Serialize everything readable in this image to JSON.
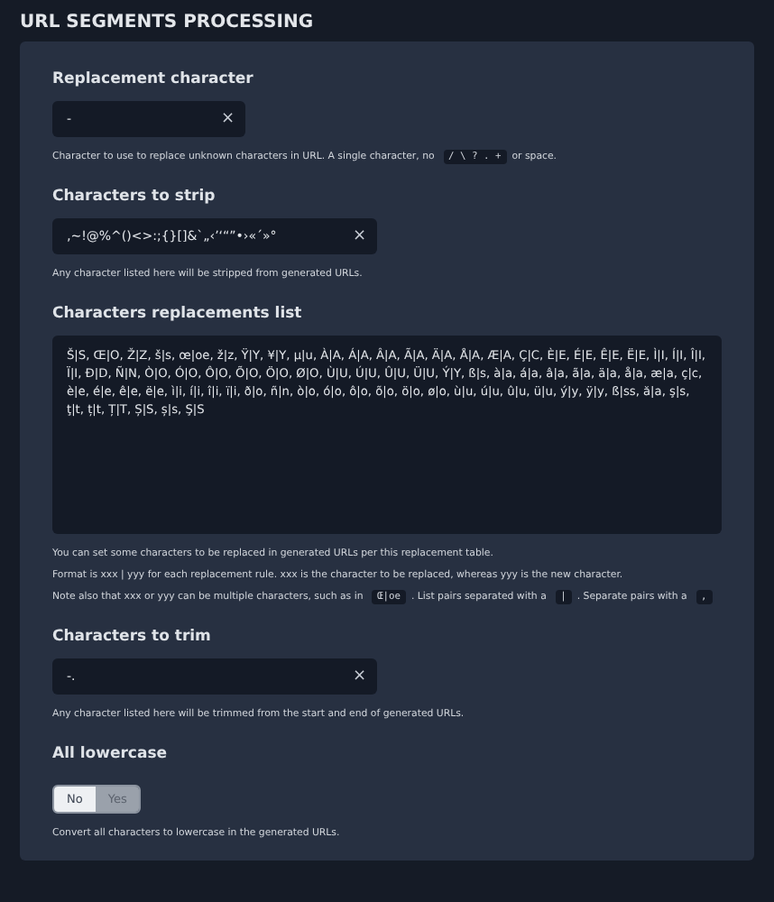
{
  "section_title": "URL SEGMENTS PROCESSING",
  "fields": [
    {
      "kind": "char-input",
      "label": "Replacement character",
      "value": "-",
      "clear": "×",
      "help": [
        [
          {
            "kind": "text",
            "text": "Character to use to replace unknown characters in URL. A single character, no"
          },
          {
            "kind": "code",
            "text": "/ \\ ? . +"
          },
          {
            "kind": "text",
            "text": "or space."
          }
        ]
      ]
    },
    {
      "kind": "text-input",
      "label": "Characters to strip",
      "value": "‚~!@%^()<>:;{}[]&`„‹’‘“”•›«´»°",
      "clear": "×",
      "help": [
        [
          {
            "kind": "text",
            "text": "Any character listed here will be stripped from generated URLs."
          }
        ]
      ]
    },
    {
      "kind": "textarea",
      "label": "Characters replacements list",
      "value": "Š|S, Œ|O, Ž|Z, š|s, œ|oe, ž|z, Ÿ|Y, ¥|Y, µ|u, À|A, Á|A, Â|A, Ã|A, Ä|A, Å|A, Æ|A, Ç|C, È|E, É|E, Ê|E, Ë|E, Ì|I, Í|I, Î|I, Ï|I, Ð|D, Ñ|N, Ò|O, Ó|O, Ô|O, Õ|O, Ö|O, Ø|O, Ù|U, Ú|U, Û|U, Ü|U, Ý|Y, ß|s, à|a, á|a, â|a, ã|a, ä|a, å|a, æ|a, ç|c, è|e, é|e, ê|e, ë|e, ì|i, í|i, î|i, ï|i, ð|o, ñ|n, ò|o, ó|o, ô|o, õ|o, ö|o, ø|o, ù|u, ú|u, û|u, ü|u, ý|y, ÿ|y, ß|ss, ă|a, ş|s, ţ|t, ț|t, Ț|T, Ș|S, ș|s, Ş|S",
      "help": [
        [
          {
            "kind": "text",
            "text": "You can set some characters to be replaced in generated URLs per this replacement table."
          }
        ],
        [
          {
            "kind": "text",
            "text": "Format is xxx | yyy for each replacement rule. xxx is the character to be replaced, whereas yyy is the new character."
          }
        ],
        [
          {
            "kind": "text",
            "text": "Note also that xxx or yyy can be multiple characters, such as in"
          },
          {
            "kind": "code",
            "text": "Œ|oe"
          },
          {
            "kind": "text",
            "text": ". List pairs separated with a"
          },
          {
            "kind": "code",
            "text": "|"
          },
          {
            "kind": "text",
            "text": ". Separate pairs with a"
          },
          {
            "kind": "code",
            "text": ","
          }
        ]
      ]
    },
    {
      "kind": "text-input",
      "label": "Characters to trim",
      "value": "-.",
      "clear": "×",
      "help": [
        [
          {
            "kind": "text",
            "text": "Any character listed here will be trimmed from the start and end of generated URLs."
          }
        ]
      ]
    },
    {
      "kind": "toggle",
      "label": "All lowercase",
      "options": [
        {
          "label": "No",
          "selected": true
        },
        {
          "label": "Yes",
          "selected": false
        }
      ],
      "help": [
        [
          {
            "kind": "text",
            "text": "Convert all characters to lowercase in the generated URLs."
          }
        ]
      ]
    }
  ]
}
